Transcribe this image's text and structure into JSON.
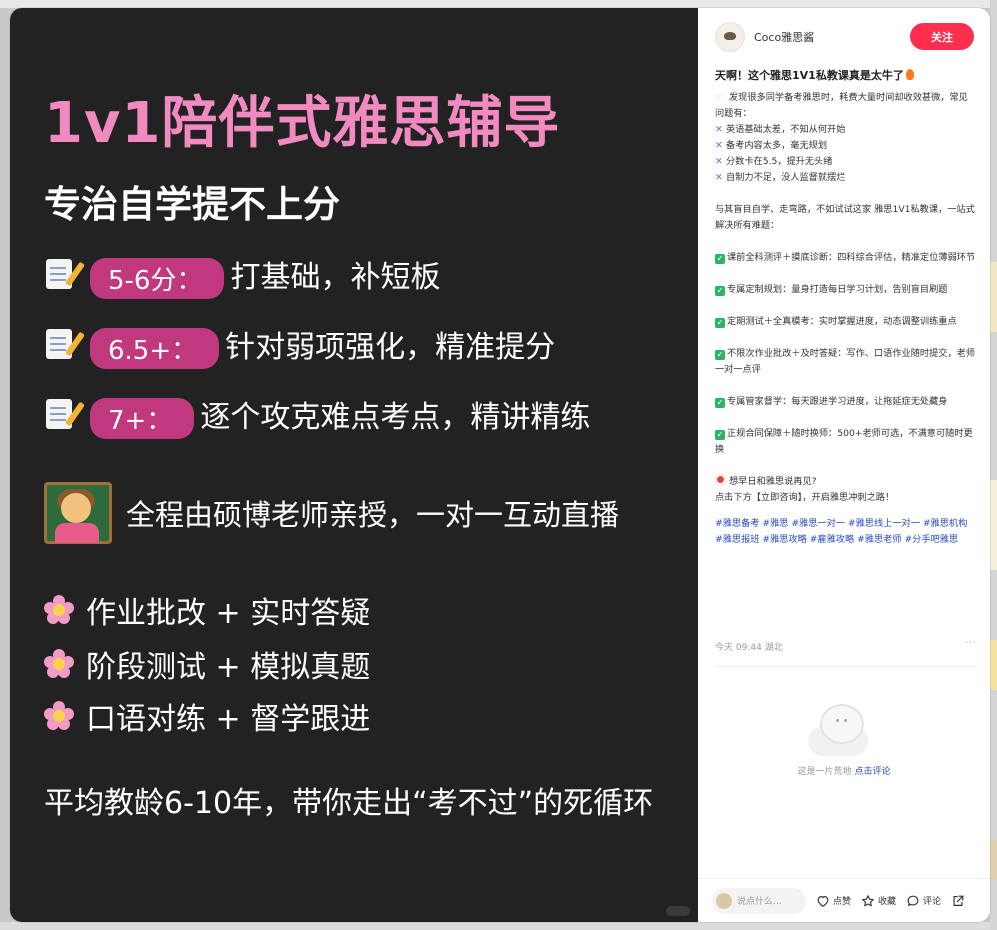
{
  "poster": {
    "title": "1v1陪伴式雅思辅导",
    "subtitle": "专治自学提不上分",
    "levels": [
      {
        "pill": "5-6分：",
        "text": "打基础，补短板"
      },
      {
        "pill": "6.5+：",
        "text": "针对弱项强化，精准提分"
      },
      {
        "pill": "7+：",
        "text": "逐个攻克难点考点，精讲精练"
      }
    ],
    "teacher_line": "全程由硕博老师亲授，一对一互动直播",
    "features": [
      "作业批改 + 实时答疑",
      "阶段测试 + 模拟真题",
      "口语对练 + 督学跟进"
    ],
    "footer": "平均教龄6-10年，带你走出“考不过”的死循环",
    "accent_color": "#f08ac0",
    "pill_color": "#c0397f"
  },
  "author": {
    "name": "Coco雅思酱",
    "follow_label": "关注"
  },
  "note": {
    "title": "天啊！这个雅思1V1私教课真是太牛了",
    "intro": "发现很多同学备考雅思时，耗费大量时间却收效甚微，常见问题有：",
    "problems": [
      "英语基础太差，不知从何开始",
      "备考内容太多，毫无规划",
      "分数卡在5.5，提升无头绪",
      "自制力不足，没人监督就摆烂"
    ],
    "pitch": "与其盲目自学、走弯路，不如试试这家 雅思1V1私教课，一站式解决所有难题：",
    "benefits": [
      "课前全科测评＋摸底诊断：四科综合评估，精准定位薄弱环节",
      "专属定制规划：量身打造每日学习计划，告别盲目刷题",
      "定期测试＋全真模考：实时掌握进度，动态调整训练重点",
      "不限次作业批改＋及时答疑：写作、口语作业随时提交，老师一对一点评",
      "专属管家督学：每天跟进学习进度，让拖延症无处藏身",
      "正规合同保障＋随时换师：500+老师可选，不满意可随时更换"
    ],
    "cta_line1": "想早日和雅思说再见?",
    "cta_line2": "点击下方【立即咨询】，开启雅思冲刺之路！",
    "tags": "#雅思备考 #雅思 #雅思一对一 #雅思线上一对一 #雅思机构 #雅思报班 #雅思攻略 #雇雅攻略 #雅思老师 #分手吧雅思",
    "meta": "今天 09:44 湖北",
    "more": "···"
  },
  "comments": {
    "empty_text": "这是一片荒地",
    "empty_link": "点击评论"
  },
  "bottombar": {
    "placeholder": "说点什么...",
    "like": "点赞",
    "collect": "收藏",
    "comment": "评论"
  },
  "colors": {
    "follow": "#ff2e4d",
    "tag": "#2a4bbf",
    "media_bg": "#222222"
  }
}
